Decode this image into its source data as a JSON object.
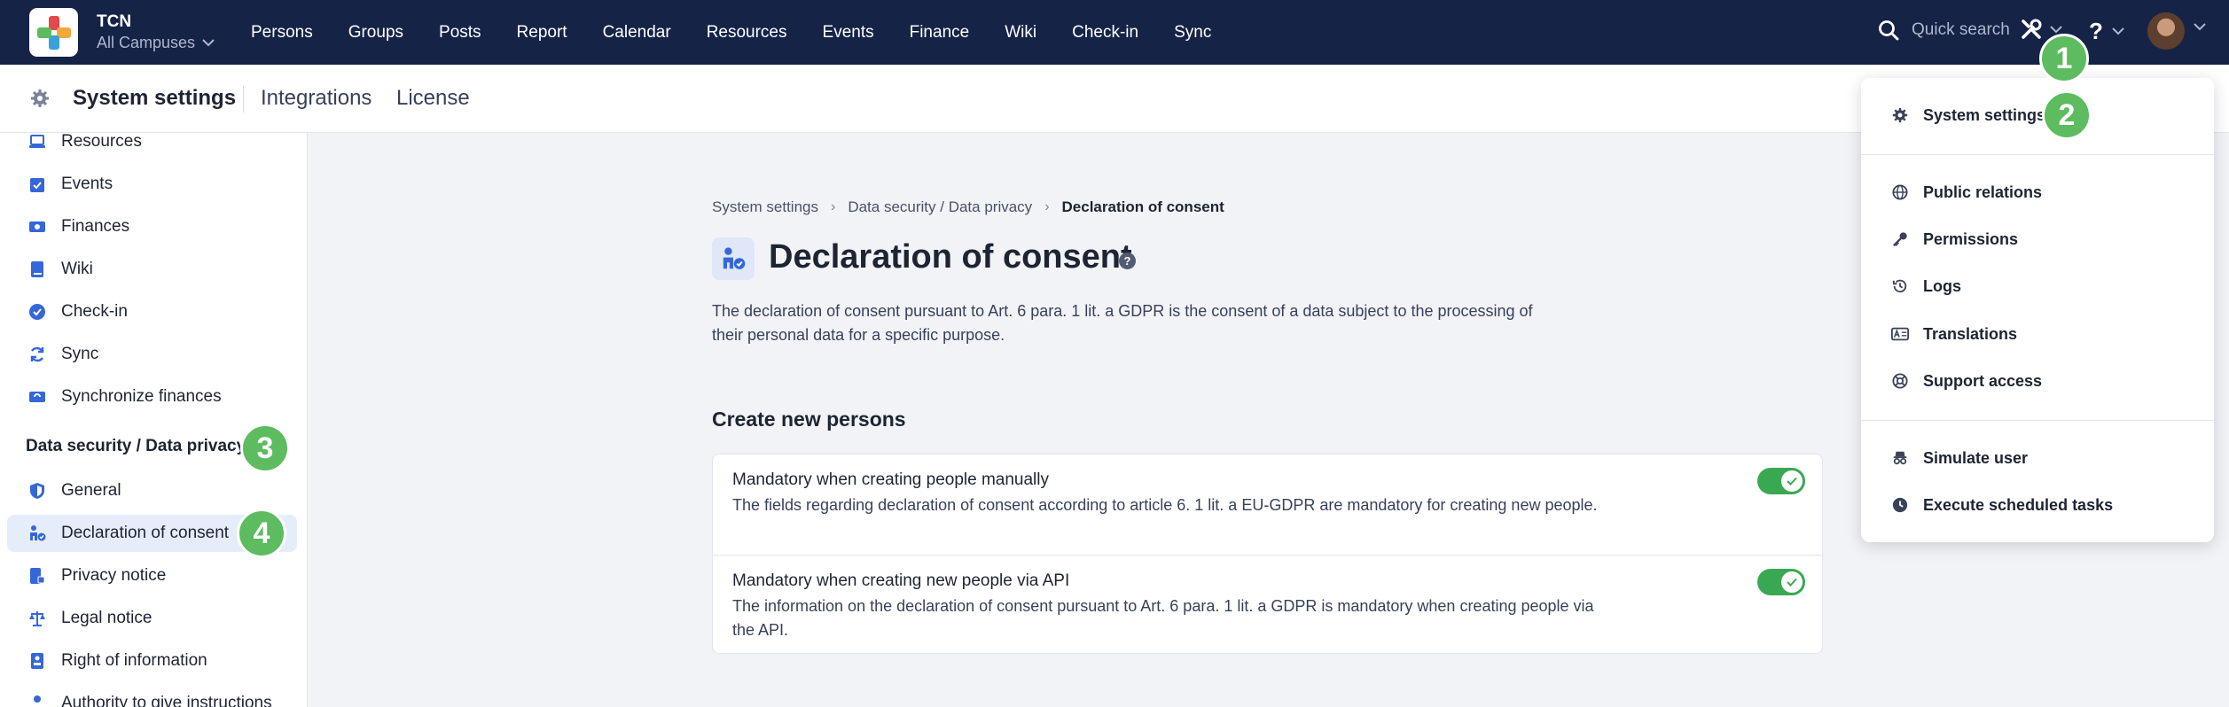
{
  "app": {
    "name": "TCN",
    "campus": "All Campuses"
  },
  "nav": [
    "Persons",
    "Groups",
    "Posts",
    "Report",
    "Calendar",
    "Resources",
    "Events",
    "Finance",
    "Wiki",
    "Check-in",
    "Sync"
  ],
  "header": {
    "search_label": "Quick search",
    "help_label": "?"
  },
  "subheader": {
    "title": "System settings",
    "links": [
      "Integrations",
      "License"
    ]
  },
  "sidebar": {
    "items_top": [
      {
        "label": "Resources",
        "icon": "laptop-icon"
      },
      {
        "label": "Events",
        "icon": "calendar-check-icon"
      },
      {
        "label": "Finances",
        "icon": "money-icon"
      },
      {
        "label": "Wiki",
        "icon": "book-icon"
      },
      {
        "label": "Check-in",
        "icon": "check-circle-icon"
      },
      {
        "label": "Sync",
        "icon": "sync-icon"
      },
      {
        "label": "Synchronize finances",
        "icon": "money-sync-icon"
      }
    ],
    "section_title": "Data security / Data privacy",
    "items_privacy": [
      {
        "label": "General",
        "icon": "shield-icon"
      },
      {
        "label": "Declaration of consent",
        "icon": "person-check-icon",
        "active": true
      },
      {
        "label": "Privacy notice",
        "icon": "document-lock-icon"
      },
      {
        "label": "Legal notice",
        "icon": "scales-icon"
      },
      {
        "label": "Right of information",
        "icon": "info-document-icon"
      },
      {
        "label": "Authority to give instructions",
        "icon": "person-icon"
      }
    ]
  },
  "breadcrumb": {
    "items": [
      "System settings",
      "Data security / Data privacy"
    ],
    "current": "Declaration of consent"
  },
  "page": {
    "title": "Declaration of consent",
    "description": "The declaration of consent pursuant to Art. 6 para. 1 lit. a GDPR is the consent of a data subject to the processing of their personal data for a specific purpose.",
    "section_title": "Create new persons",
    "settings": [
      {
        "title": "Mandatory when creating people manually",
        "description": "The fields regarding declaration of consent according to article 6. 1 lit. a EU-GDPR are mandatory for creating new people.",
        "enabled": true
      },
      {
        "title": "Mandatory when creating new people via API",
        "description": "The information on the declaration of consent pursuant to Art. 6 para. 1 lit. a GDPR is mandatory when creating people via the API.",
        "enabled": true
      }
    ]
  },
  "dropdown": {
    "items": [
      {
        "label": "System settings",
        "icon": "gear-icon"
      },
      {
        "label": "Public relations",
        "icon": "globe-icon"
      },
      {
        "label": "Permissions",
        "icon": "key-icon"
      },
      {
        "label": "Logs",
        "icon": "history-icon"
      },
      {
        "label": "Translations",
        "icon": "translate-icon"
      },
      {
        "label": "Support access",
        "icon": "lifebuoy-icon"
      },
      {
        "label": "Simulate user",
        "icon": "incognito-icon"
      },
      {
        "label": "Execute scheduled tasks",
        "icon": "clock-icon"
      }
    ]
  },
  "markers": [
    "1",
    "2",
    "3",
    "4"
  ],
  "colors": {
    "topbar": "#152347",
    "accent_green": "#5cbc5f",
    "toggle_on": "#3aa853",
    "active_item": "#e6edfa",
    "icon_blue": "#3567d8"
  }
}
